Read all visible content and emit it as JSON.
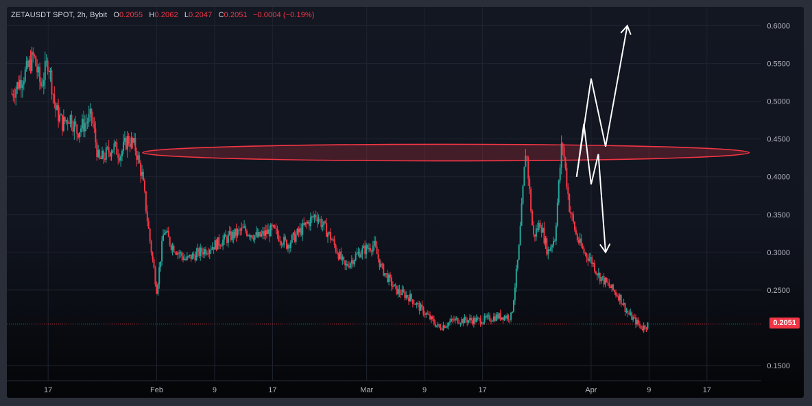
{
  "header": {
    "symbol": "ZETAUSDT SPOT, 2h, Bybit",
    "open_label": "O",
    "open": "0.2055",
    "high_label": "H",
    "high": "0.2062",
    "low_label": "L",
    "low": "0.2047",
    "close_label": "C",
    "close": "0.2051",
    "change": "−0.0004 (−0.19%)"
  },
  "last_price": "0.2051",
  "colors": {
    "up": "#26a69a",
    "down": "#f23645",
    "zone": "#f23645",
    "arrows": "#ffffff"
  },
  "chart_data": {
    "type": "candlestick",
    "title": "ZETAUSDT SPOT, 2h, Bybit",
    "y_ticks": [
      "0.6000",
      "0.5500",
      "0.5000",
      "0.4500",
      "0.4000",
      "0.3500",
      "0.3000",
      "0.2500",
      "0.1500"
    ],
    "x_ticks": [
      "17",
      "Feb",
      "9",
      "17",
      "Mar",
      "9",
      "17",
      "Apr",
      "9",
      "17"
    ],
    "ylim": [
      0.13,
      0.625
    ],
    "grid": true,
    "last_price": 0.2051,
    "price_path": [
      [
        "Jan 12",
        0.51
      ],
      [
        "Jan 14",
        0.54
      ],
      [
        "Jan 15",
        0.56
      ],
      [
        "Jan 16",
        0.52
      ],
      [
        "Jan 17",
        0.555
      ],
      [
        "Jan 18",
        0.49
      ],
      [
        "Jan 19",
        0.47
      ],
      [
        "Jan 20",
        0.48
      ],
      [
        "Jan 21",
        0.46
      ],
      [
        "Jan 22",
        0.47
      ],
      [
        "Jan 23",
        0.48
      ],
      [
        "Jan 24",
        0.42
      ],
      [
        "Jan 25",
        0.43
      ],
      [
        "Jan 26",
        0.44
      ],
      [
        "Jan 27",
        0.43
      ],
      [
        "Jan 28",
        0.45
      ],
      [
        "Jan 29",
        0.44
      ],
      [
        "Jan 30",
        0.4
      ],
      [
        "Jan 31",
        0.32
      ],
      [
        "Feb 1",
        0.25
      ],
      [
        "Feb 2",
        0.33
      ],
      [
        "Feb 3",
        0.31
      ],
      [
        "Feb 5",
        0.29
      ],
      [
        "Feb 7",
        0.3
      ],
      [
        "Feb 9",
        0.31
      ],
      [
        "Feb 11",
        0.32
      ],
      [
        "Feb 13",
        0.33
      ],
      [
        "Feb 15",
        0.32
      ],
      [
        "Feb 17",
        0.33
      ],
      [
        "Feb 19",
        0.31
      ],
      [
        "Feb 21",
        0.33
      ],
      [
        "Feb 23",
        0.35
      ],
      [
        "Feb 25",
        0.32
      ],
      [
        "Feb 27",
        0.28
      ],
      [
        "Feb 29",
        0.3
      ],
      [
        "Mar 2",
        0.31
      ],
      [
        "Mar 3",
        0.28
      ],
      [
        "Mar 5",
        0.25
      ],
      [
        "Mar 7",
        0.24
      ],
      [
        "Mar 9",
        0.22
      ],
      [
        "Mar 11",
        0.2
      ],
      [
        "Mar 13",
        0.21
      ],
      [
        "Mar 15",
        0.21
      ],
      [
        "Mar 17",
        0.21
      ],
      [
        "Mar 19",
        0.215
      ],
      [
        "Mar 21",
        0.215
      ],
      [
        "Mar 22",
        0.3
      ],
      [
        "Mar 23",
        0.44
      ],
      [
        "Mar 24",
        0.32
      ],
      [
        "Mar 25",
        0.34
      ],
      [
        "Mar 26",
        0.3
      ],
      [
        "Mar 27",
        0.32
      ],
      [
        "Mar 28",
        0.45
      ],
      [
        "Mar 29",
        0.36
      ],
      [
        "Mar 30",
        0.32
      ],
      [
        "Mar 31",
        0.3
      ],
      [
        "Apr 1",
        0.29
      ],
      [
        "Apr 2",
        0.27
      ],
      [
        "Apr 3",
        0.26
      ],
      [
        "Apr 4",
        0.25
      ],
      [
        "Apr 5",
        0.24
      ],
      [
        "Apr 6",
        0.22
      ],
      [
        "Apr 7",
        0.21
      ],
      [
        "Apr 8",
        0.2
      ],
      [
        "Apr 9",
        0.2051
      ]
    ],
    "resistance_zone": {
      "y_center": 0.432,
      "y_top": 0.443,
      "y_bottom": 0.421,
      "x_start": "Jan 31",
      "x_end": "Apr 20"
    },
    "arrow_up_path": [
      [
        "Mar 30",
        0.4
      ],
      [
        "Mar 31",
        0.47
      ],
      [
        "Apr 1",
        0.39
      ],
      [
        "Apr 2",
        0.43
      ],
      [
        "Apr 3",
        0.3
      ]
    ],
    "arrow_up_continuation": [
      [
        "Mar 30",
        0.4
      ],
      [
        "Apr 1",
        0.53
      ],
      [
        "Apr 3",
        0.44
      ],
      [
        "Apr 6",
        0.6
      ]
    ]
  }
}
